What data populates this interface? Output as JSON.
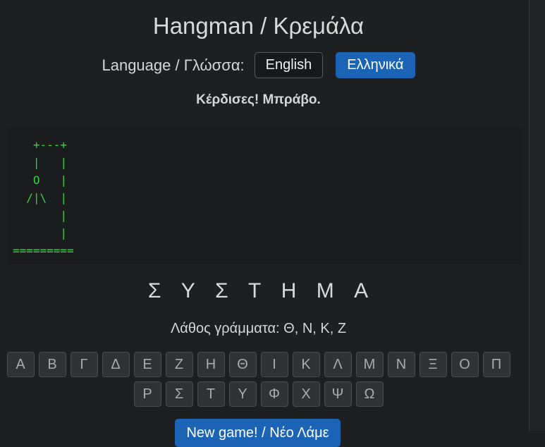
{
  "title": "Hangman / Κρεμάλα",
  "language": {
    "label": "Language / Γλώσσα:",
    "english": "English",
    "greek": "Ελληνικά"
  },
  "status": "Κέρδισες! Μπράβο.",
  "gallows_art": "   +---+\n   |   |\n   O   |\n  /|\\  |\n       |\n       |\n=========",
  "word_letters": [
    "Σ",
    "Υ",
    "Σ",
    "Τ",
    "Η",
    "Μ",
    "Α"
  ],
  "wrong_letters": "Λάθος γράμματα: Θ, Ν, Κ, Ζ",
  "keyboard": {
    "row1": [
      "Α",
      "Β",
      "Γ",
      "Δ",
      "Ε",
      "Ζ",
      "Η",
      "Θ",
      "Ι",
      "Κ",
      "Λ",
      "Μ",
      "Ν",
      "Ξ",
      "Ο",
      "Π"
    ],
    "row2": [
      "Ρ",
      "Σ",
      "Τ",
      "Υ",
      "Φ",
      "Χ",
      "Ψ",
      "Ω"
    ]
  },
  "new_game": "New game! / Νέο Λάμε",
  "colors": {
    "accent": "#1b64b5",
    "ascii": "#2fd34a",
    "background": "#1e1f20"
  }
}
